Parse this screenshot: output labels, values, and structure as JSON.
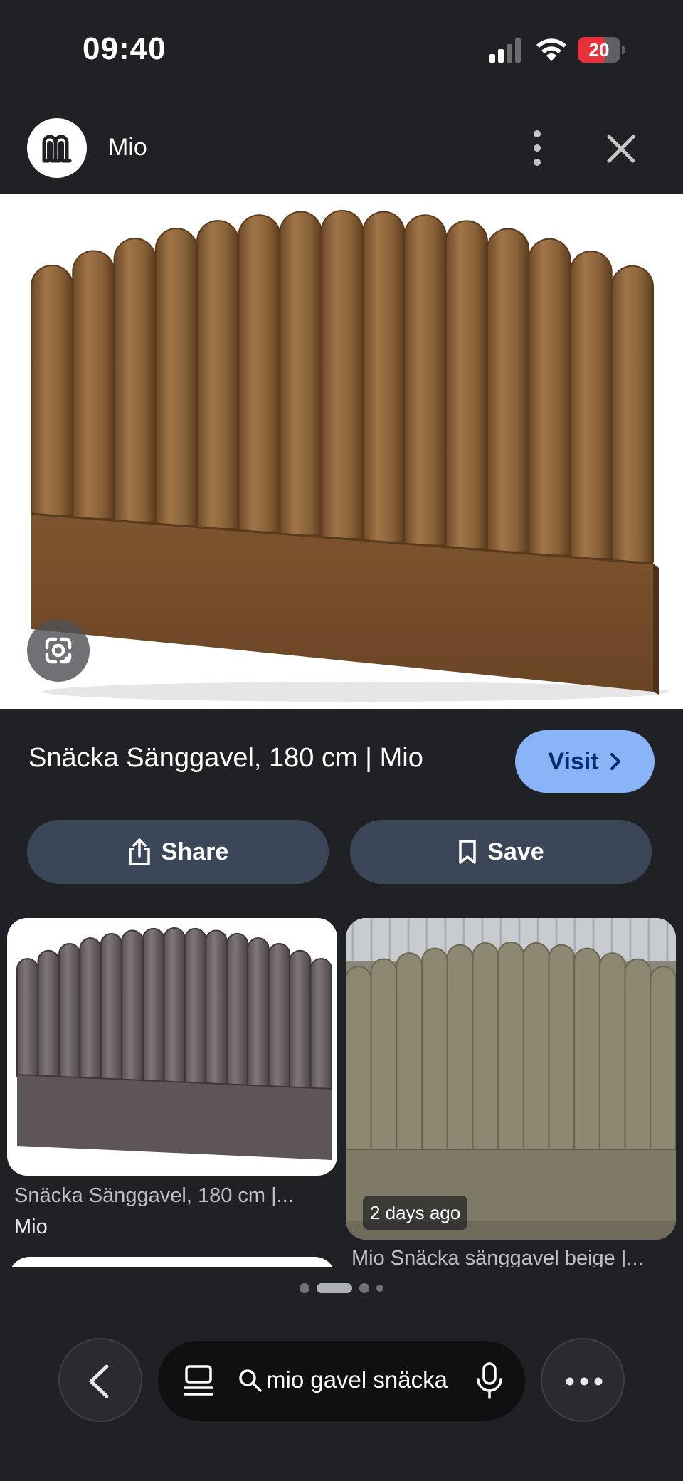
{
  "status_bar": {
    "time": "09:40",
    "battery": "20"
  },
  "header": {
    "site_name": "Mio"
  },
  "result": {
    "title": "Snäcka Sänggavel, 180 cm | Mio",
    "visit_label": "Visit",
    "share_label": "Share",
    "save_label": "Save"
  },
  "related": [
    {
      "title": "Snäcka Sänggavel, 180 cm |...",
      "source": "Mio"
    },
    {
      "title": "Mio Snäcka sänggavel beige |...",
      "time_badge": "2 days ago"
    }
  ],
  "bottom_bar": {
    "search_query": "mio gavel snäcka"
  },
  "colors": {
    "accent": "#8ab4f8",
    "background": "#202124",
    "button": "#3c4659",
    "battery_low": "#e8313b"
  }
}
